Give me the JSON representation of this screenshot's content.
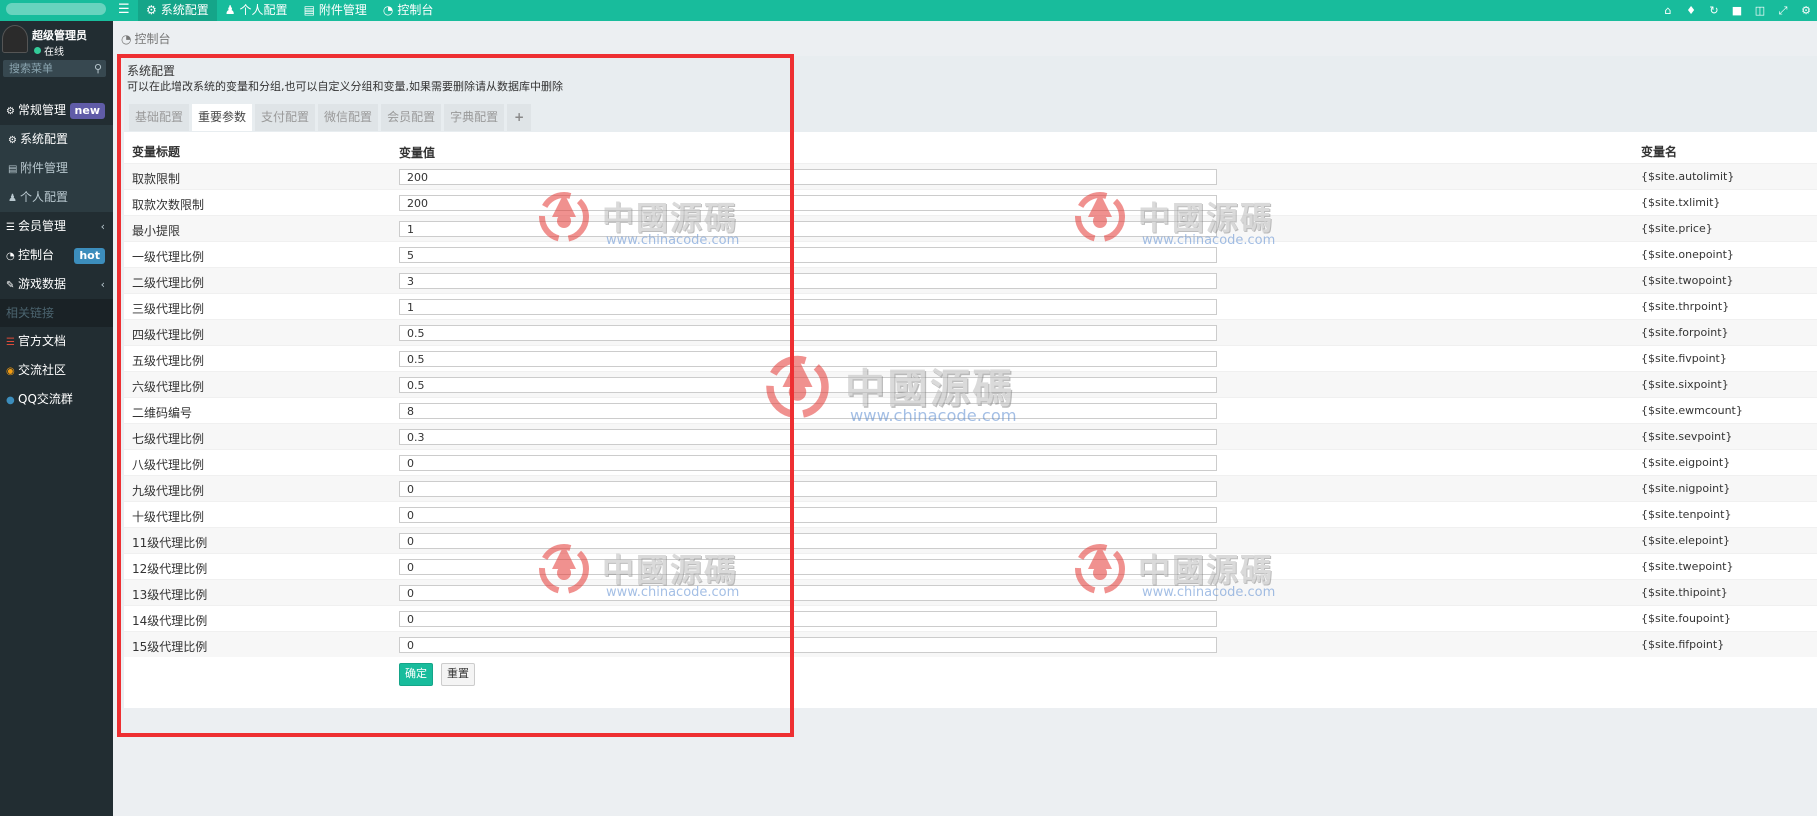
{
  "topbar": {
    "tabs": [
      {
        "label": "系统配置",
        "icon": "gear-icon",
        "active": true
      },
      {
        "label": "个人配置",
        "icon": "user-icon",
        "active": false
      },
      {
        "label": "附件管理",
        "icon": "file-icon",
        "active": false
      },
      {
        "label": "控制台",
        "icon": "dashboard-icon",
        "active": false
      }
    ],
    "right_icons": [
      "home-icon",
      "bell-icon",
      "refresh-icon",
      "trash-icon",
      "translate-icon",
      "fullscreen-icon",
      "settings-icon"
    ]
  },
  "sidebar": {
    "user": {
      "name": "超级管理员",
      "status": "在线"
    },
    "search": {
      "placeholder": "搜索菜单"
    },
    "items": [
      {
        "label": "常规管理",
        "icon": "cogs-icon",
        "badge": "new"
      },
      {
        "label": "系统配置",
        "icon": "gear-icon"
      },
      {
        "label": "附件管理",
        "icon": "file-icon"
      },
      {
        "label": "个人配置",
        "icon": "user-icon"
      },
      {
        "label": "会员管理",
        "icon": "list-icon"
      },
      {
        "label": "控制台",
        "icon": "dashboard-icon",
        "badge": "hot"
      },
      {
        "label": "游戏数据",
        "icon": "edit-icon"
      },
      {
        "label": "相关链接"
      },
      {
        "label": "官方文档",
        "icon": "list-icon"
      },
      {
        "label": "交流社区",
        "icon": "comment-icon"
      },
      {
        "label": "QQ交流群",
        "icon": "qq-icon"
      }
    ]
  },
  "breadcrumb": {
    "label": "控制台"
  },
  "panel": {
    "title": "系统配置",
    "description": "可以在此增改系统的变量和分组,也可以自定义分组和变量,如果需要删除请从数据库中删除",
    "tabs": [
      "基础配置",
      "重要参数",
      "支付配置",
      "微信配置",
      "会员配置",
      "字典配置",
      "+"
    ],
    "active_tab": "重要参数"
  },
  "table": {
    "headers": {
      "title": "变量标题",
      "value": "变量值",
      "name": "变量名"
    },
    "rows": [
      {
        "title": "取款限制",
        "value": "200",
        "name": "{$site.autolimit}"
      },
      {
        "title": "取款次数限制",
        "value": "200",
        "name": "{$site.txlimit}"
      },
      {
        "title": "最小提限",
        "value": "1",
        "name": "{$site.price}"
      },
      {
        "title": "一级代理比例",
        "value": "5",
        "name": "{$site.onepoint}"
      },
      {
        "title": "二级代理比例",
        "value": "3",
        "name": "{$site.twopoint}"
      },
      {
        "title": "三级代理比例",
        "value": "1",
        "name": "{$site.thrpoint}"
      },
      {
        "title": "四级代理比例",
        "value": "0.5",
        "name": "{$site.forpoint}"
      },
      {
        "title": "五级代理比例",
        "value": "0.5",
        "name": "{$site.fivpoint}"
      },
      {
        "title": "六级代理比例",
        "value": "0.5",
        "name": "{$site.sixpoint}"
      },
      {
        "title": "二维码编号",
        "value": "8",
        "name": "{$site.ewmcount}"
      },
      {
        "title": "七级代理比例",
        "value": "0.3",
        "name": "{$site.sevpoint}"
      },
      {
        "title": "八级代理比例",
        "value": "0",
        "name": "{$site.eigpoint}"
      },
      {
        "title": "九级代理比例",
        "value": "0",
        "name": "{$site.nigpoint}"
      },
      {
        "title": "十级代理比例",
        "value": "0",
        "name": "{$site.tenpoint}"
      },
      {
        "title": "11级代理比例",
        "value": "0",
        "name": "{$site.elepoint}"
      },
      {
        "title": "12级代理比例",
        "value": "0",
        "name": "{$site.twepoint}"
      },
      {
        "title": "13级代理比例",
        "value": "0",
        "name": "{$site.thipoint}"
      },
      {
        "title": "14级代理比例",
        "value": "0",
        "name": "{$site.foupoint}"
      },
      {
        "title": "15级代理比例",
        "value": "0",
        "name": "{$site.fifpoint}"
      }
    ],
    "submit_label": "确定",
    "reset_label": "重置"
  },
  "watermark": {
    "text": "中國源碼",
    "url": "www.chinacode.com"
  },
  "colors": {
    "accent": "#18bc9c",
    "sidebar": "#222d32",
    "highlight": "#ee2f32"
  }
}
